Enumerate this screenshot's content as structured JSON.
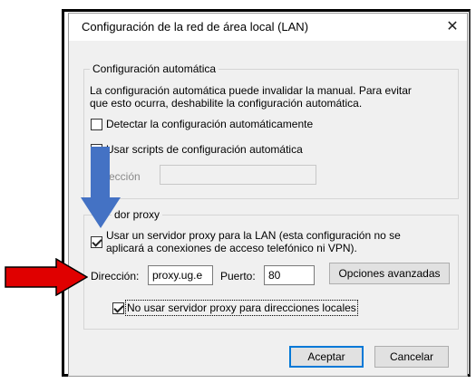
{
  "dialog": {
    "title": "Configuración de la red de área local (LAN)",
    "close_symbol": "✕"
  },
  "auto_config": {
    "legend": "Configuración automática",
    "description_line1": "La configuración automática puede invalidar la manual. Para evitar",
    "description_line2": "que esto ocurra, deshabilite la configuración automática.",
    "detect_label": "Detectar la configuración automáticamente",
    "detect_checked": false,
    "scripts_label": "Usar scripts de configuración automática",
    "scripts_checked": false,
    "address_label": "ección",
    "address_value": ""
  },
  "proxy": {
    "legend": "dor proxy",
    "use_proxy_line1": "Usar un servidor proxy para la LAN (esta configuración no se",
    "use_proxy_line2": "aplicará a conexiones de acceso telefónico ni VPN).",
    "use_proxy_checked": true,
    "address_label": "Dirección:",
    "address_value": "proxy.ug.e",
    "port_label": "Puerto:",
    "port_value": "80",
    "advanced_button": "Opciones avanzadas",
    "bypass_label": "No usar servidor proxy para direcciones locales",
    "bypass_checked": true
  },
  "buttons": {
    "accept": "Aceptar",
    "cancel": "Cancelar"
  },
  "annotations": {
    "blue_arrow_color": "#4472c4",
    "red_arrow_color": "#e00000"
  }
}
